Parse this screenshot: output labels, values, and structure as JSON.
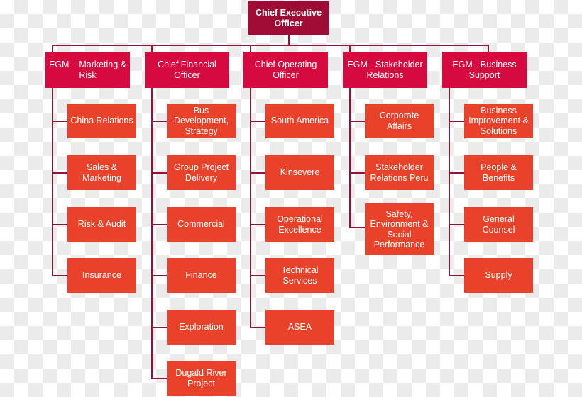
{
  "chart_data": {
    "type": "diagram",
    "subtype": "organisational-hierarchy-tree",
    "title": "Chief Executive Officer organisational chart",
    "orientation": "top-down with left-aligned vertical spines per branch",
    "levels": 3,
    "colors": {
      "level1_box": "#9E0B35",
      "level2_box": "#D50A3F",
      "level3_box": "#E8432A",
      "connector_line": "#8D1638",
      "text": "#FFFFFF",
      "background_checker_light": "#FFFFFF",
      "background_checker_dark": "#ECECEC"
    },
    "counts": {
      "level1_nodes": 1,
      "level2_nodes": 5,
      "level3_nodes": 21,
      "total_nodes": 27
    },
    "root": {
      "id": "ceo",
      "label": "Chief Executive Officer",
      "level": 1,
      "children_count": 5
    },
    "branches": [
      {
        "id": "egm-marketing-risk",
        "label": "EGM – Marketing & Risk",
        "level": 2,
        "column": 1,
        "children_count": 4,
        "children": [
          {
            "id": "china-relations",
            "label": "China Relations",
            "level": 3
          },
          {
            "id": "sales-marketing",
            "label": "Sales & Marketing",
            "level": 3
          },
          {
            "id": "risk-audit",
            "label": "Risk & Audit",
            "level": 3
          },
          {
            "id": "insurance",
            "label": "Insurance",
            "level": 3
          }
        ]
      },
      {
        "id": "chief-financial-officer",
        "label": "Chief Financial Officer",
        "level": 2,
        "column": 2,
        "children_count": 6,
        "children": [
          {
            "id": "bus-development-strategy",
            "label": "Bus Development, Strategy",
            "level": 3
          },
          {
            "id": "group-project-delivery",
            "label": "Group Project Delivery",
            "level": 3
          },
          {
            "id": "commercial",
            "label": "Commercial",
            "level": 3
          },
          {
            "id": "finance",
            "label": "Finance",
            "level": 3
          },
          {
            "id": "exploration",
            "label": "Exploration",
            "level": 3
          },
          {
            "id": "dugald-river-project",
            "label": "Dugald River Project",
            "level": 3
          }
        ]
      },
      {
        "id": "chief-operating-officer",
        "label": "Chief Operating Officer",
        "level": 2,
        "column": 3,
        "children_count": 5,
        "children": [
          {
            "id": "south-america",
            "label": "South America",
            "level": 3
          },
          {
            "id": "kinsevere",
            "label": "Kinsevere",
            "level": 3
          },
          {
            "id": "operational-excellence",
            "label": "Operational Excellence",
            "level": 3
          },
          {
            "id": "technical-services",
            "label": "Technical Services",
            "level": 3
          },
          {
            "id": "asea",
            "label": "ASEA",
            "level": 3
          }
        ]
      },
      {
        "id": "egm-stakeholder-relations",
        "label": "EGM - Stakeholder Relations",
        "level": 2,
        "column": 4,
        "children_count": 3,
        "children": [
          {
            "id": "corporate-affairs",
            "label": "Corporate Affairs",
            "level": 3
          },
          {
            "id": "stakeholder-relations-peru",
            "label": "Stakeholder Relations Peru",
            "level": 3
          },
          {
            "id": "safety-environment-social-performance",
            "label": "Safety, Environment & Social Performance",
            "level": 3
          }
        ]
      },
      {
        "id": "egm-business-support",
        "label": "EGM - Business Support",
        "level": 2,
        "column": 5,
        "children_count": 4,
        "children": [
          {
            "id": "business-improvement-solutions",
            "label": "Business Improvement & Solutions",
            "level": 3
          },
          {
            "id": "people-benefits",
            "label": "People & Benefits",
            "level": 3
          },
          {
            "id": "general-counsel",
            "label": "General Counsel",
            "level": 3
          },
          {
            "id": "supply",
            "label": "Supply",
            "level": 3
          }
        ]
      }
    ]
  }
}
